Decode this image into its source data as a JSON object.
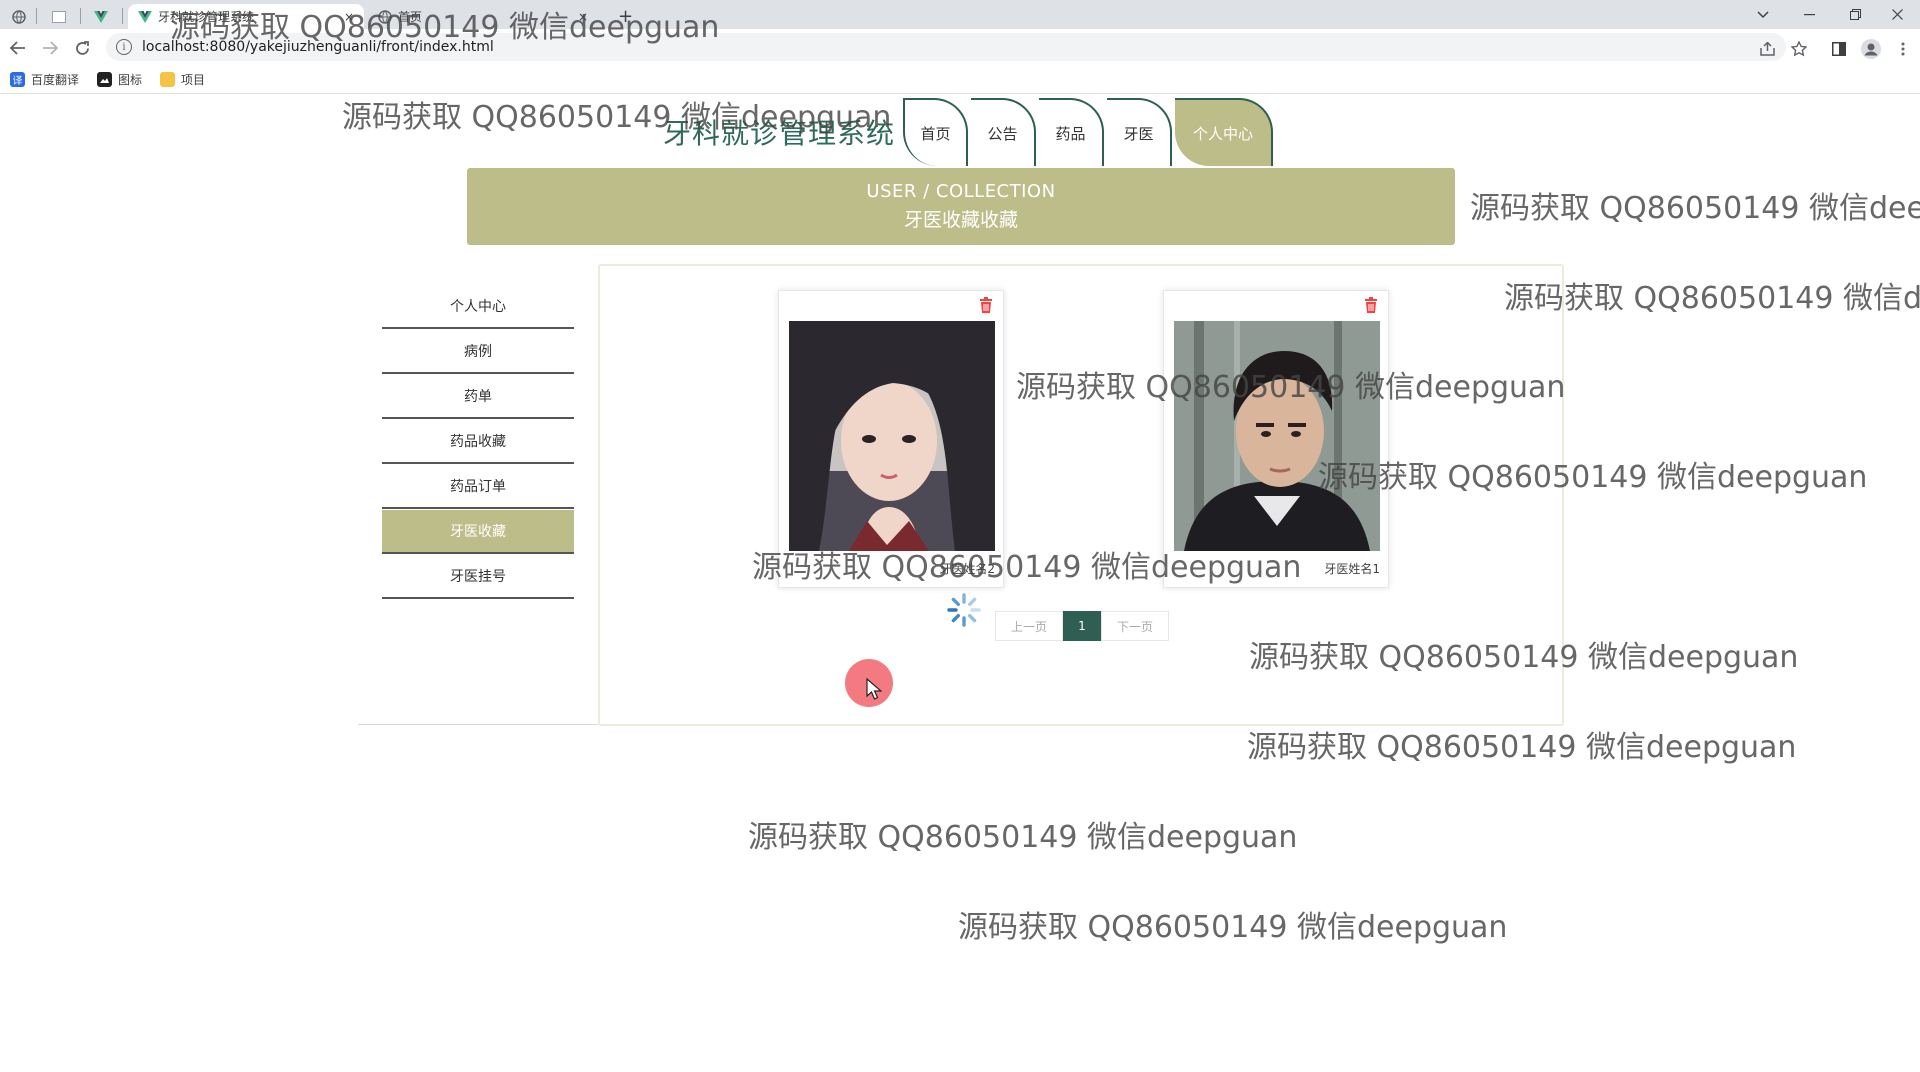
{
  "browser": {
    "tabs": [
      {
        "icon": "globe-icon",
        "title": ""
      },
      {
        "icon": "blank-page-icon",
        "title": ""
      },
      {
        "icon": "vue-icon",
        "title": ""
      },
      {
        "icon": "vue-icon",
        "title": "牙科就诊管理系统"
      },
      {
        "icon": "globe-icon",
        "title": "首页"
      }
    ],
    "new_tab_label": "+",
    "close_tab_label": "×",
    "url": "localhost:8080/yakejiuzhenguanli/front/index.html",
    "bookmarks": [
      {
        "label": "百度翻译",
        "color": "#2b6de5"
      },
      {
        "label": "图标",
        "color": "#222222"
      },
      {
        "label": "项目",
        "color": "#f6c445"
      }
    ]
  },
  "site": {
    "title": "牙科就诊管理系统",
    "nav": [
      "首页",
      "公告",
      "药品",
      "牙医",
      "个人中心"
    ],
    "active_nav": "个人中心",
    "accent_color": "#bdbd8a",
    "dark_color": "#2f5e52"
  },
  "banner": {
    "en": "USER / COLLECTION",
    "cn": "牙医收藏收藏"
  },
  "sidebar": {
    "items": [
      "个人中心",
      "病例",
      "药单",
      "药品收藏",
      "药品订单",
      "牙医收藏",
      "牙医挂号"
    ],
    "active": "牙医收藏"
  },
  "collection": {
    "cards": [
      {
        "name": "牙医姓名2",
        "portrait": "female"
      },
      {
        "name": "牙医姓名1",
        "portrait": "male"
      }
    ]
  },
  "pager": {
    "prev": "上一页",
    "current": "1",
    "next": "下一页"
  },
  "watermark": {
    "text": "源码获取 QQ86050149 微信deepguan"
  }
}
